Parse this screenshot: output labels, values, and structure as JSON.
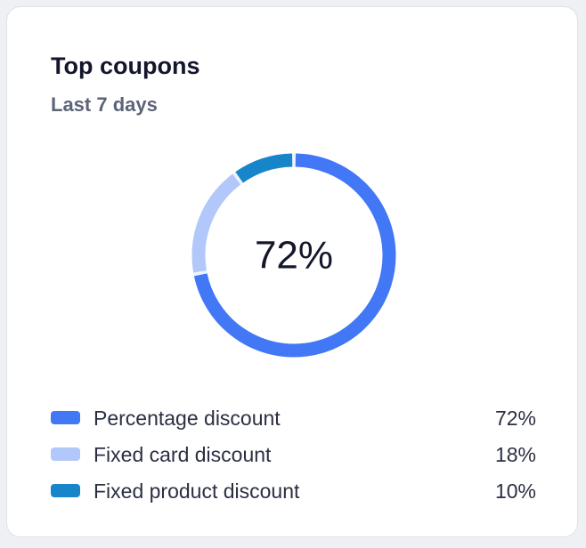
{
  "card": {
    "title": "Top coupons",
    "subtitle": "Last 7 days"
  },
  "chart_data": {
    "type": "pie",
    "variant": "donut",
    "center_label": "72%",
    "categories": [
      "Percentage discount",
      "Fixed card discount",
      "Fixed product discount"
    ],
    "values": [
      72,
      18,
      10
    ],
    "value_labels": [
      "72%",
      "18%",
      "10%"
    ],
    "colors": [
      "#4277f5",
      "#b2c8fb",
      "#1685c9"
    ],
    "track_color": "#eef3fd",
    "legend_position": "bottom"
  }
}
